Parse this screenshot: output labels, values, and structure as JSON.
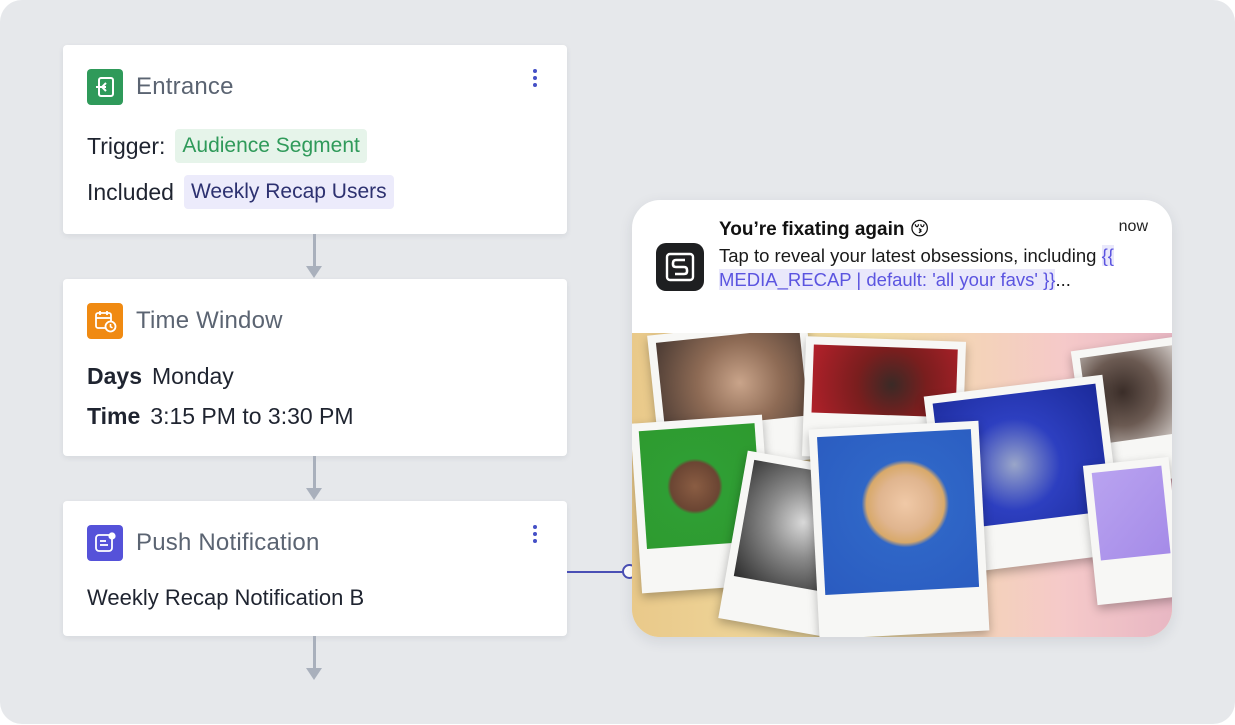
{
  "flow": {
    "entrance": {
      "title": "Entrance",
      "icon": "enter-icon",
      "icon_color": "#2f9a5a",
      "trigger_label": "Trigger:",
      "trigger_value": "Audience Segment",
      "included_label": "Included",
      "included_value": "Weekly Recap Users"
    },
    "time_window": {
      "title": "Time Window",
      "icon": "calendar-clock-icon",
      "icon_color": "#f08a12",
      "days_label": "Days",
      "days_value": "Monday",
      "time_label": "Time",
      "time_value": "3:15 PM to 3:30 PM"
    },
    "push": {
      "title": "Push Notification",
      "icon": "notification-icon",
      "icon_color": "#5552d9",
      "name": "Weekly Recap Notification B"
    }
  },
  "notification": {
    "title": "You’re fixating again 😚",
    "time": "now",
    "body_prefix": "Tap to reveal your latest obsessions, including ",
    "body_token": "{{ MEDIA_RECAP | default: 'all your favs' }}",
    "body_suffix": "...",
    "app_icon": "app-logo-icon"
  },
  "colors": {
    "accent": "#4550c6",
    "connector": "#a9b0bc",
    "background": "#e6e8eb"
  }
}
